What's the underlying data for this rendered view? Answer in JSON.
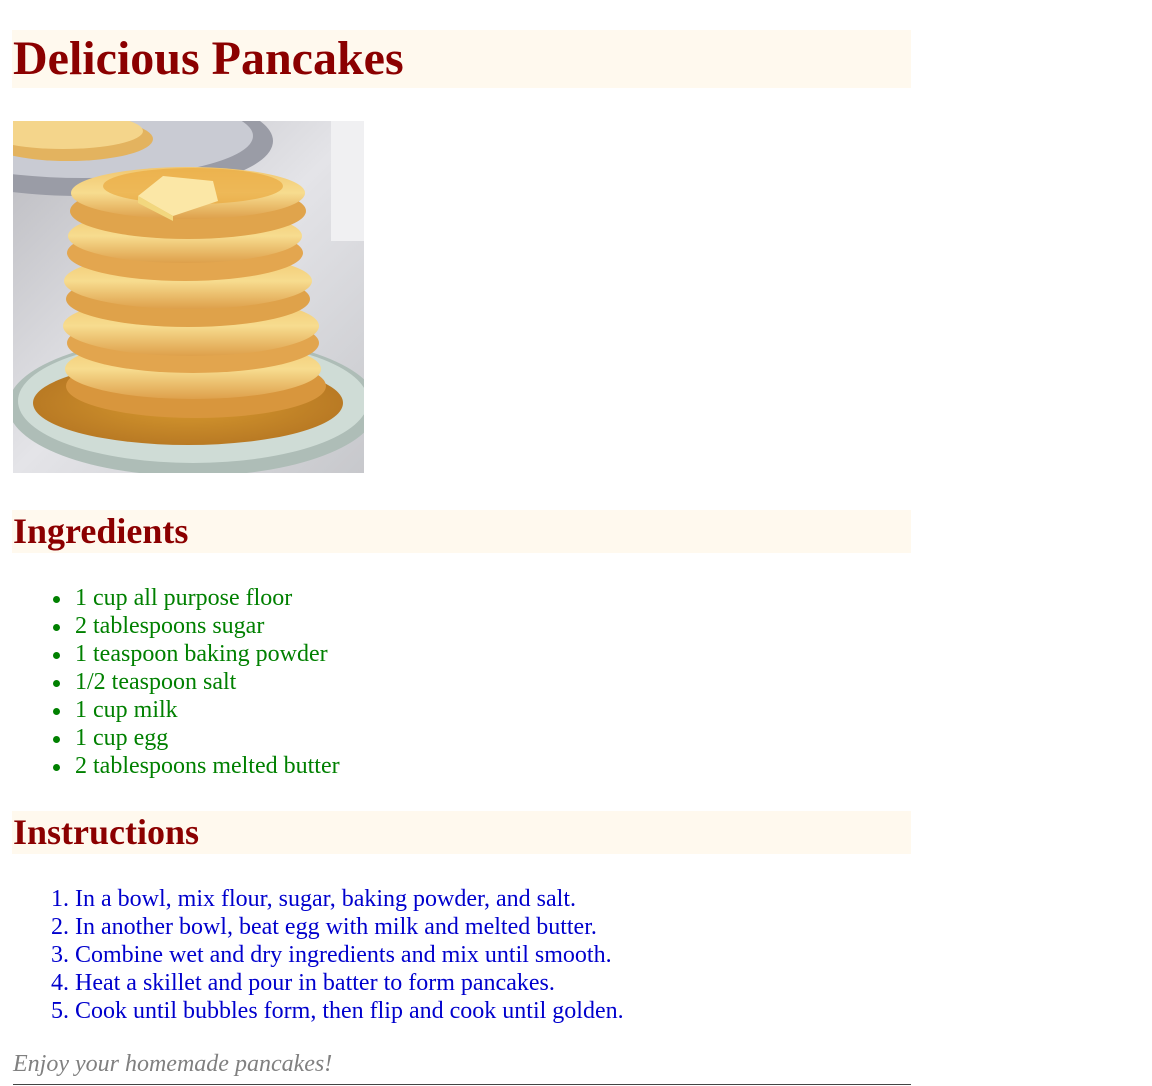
{
  "title": "Delicious Pancakes",
  "image": {
    "alt": "Stack of pancakes with butter and syrup"
  },
  "ingredients": {
    "heading": "Ingredients",
    "items": [
      "1 cup all purpose floor",
      "2 tablespoons sugar",
      "1 teaspoon baking powder",
      "1/2 teaspoon salt",
      "1 cup milk",
      "1 cup egg",
      "2 tablespoons melted butter"
    ]
  },
  "instructions": {
    "heading": "Instructions",
    "steps": [
      {
        "num": "1.",
        "text": "In a bowl, mix flour, sugar, baking powder, and salt."
      },
      {
        "num": "2.",
        "text": "In another bowl, beat egg with milk and melted butter."
      },
      {
        "num": "3.",
        "text": "Combine wet and dry ingredients and mix until smooth."
      },
      {
        "num": "4.",
        "text": "Heat a skillet and pour in batter to form pancakes."
      },
      {
        "num": "5.",
        "text": "Cook until bubbles form, then flip and cook until golden."
      }
    ]
  },
  "footer": {
    "note": "Enjoy your homemade pancakes!"
  },
  "colors": {
    "heading_text": "#8b0000",
    "heading_bg": "#fff9ee",
    "ingredients_text": "#008000",
    "instructions_text": "#0000cd",
    "footer_text": "#808080"
  }
}
